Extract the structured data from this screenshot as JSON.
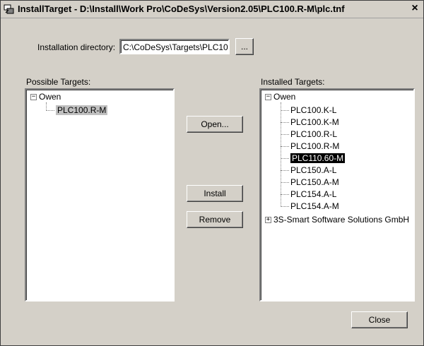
{
  "window": {
    "title": "InstallTarget - D:\\Install\\Work Pro\\CoDeSys\\Version2.05\\PLC100.R-M\\plc.tnf",
    "close_glyph": "×"
  },
  "install_dir": {
    "label": "Installation directory:",
    "value": "C:\\CoDeSys\\Targets\\PLC10",
    "browse_label": "..."
  },
  "possible": {
    "label": "Possible Targets:",
    "root": "Owen",
    "children": [
      "PLC100.R-M"
    ]
  },
  "installed": {
    "label": "Installed Targets:",
    "root": "Owen",
    "children": [
      "PLC100.K-L",
      "PLC100.K-M",
      "PLC100.R-L",
      "PLC100.R-M",
      "PLC110.60-M",
      "PLC150.A-L",
      "PLC150.A-M",
      "PLC154.A-L",
      "PLC154.A-M"
    ],
    "selected": "PLC110.60-M",
    "other_root": "3S-Smart Software Solutions GmbH"
  },
  "buttons": {
    "open": "Open...",
    "install": "Install",
    "remove": "Remove",
    "close": "Close"
  },
  "icons": {
    "app": "install-target-icon",
    "expand_minus": "−",
    "expand_plus": "+"
  }
}
